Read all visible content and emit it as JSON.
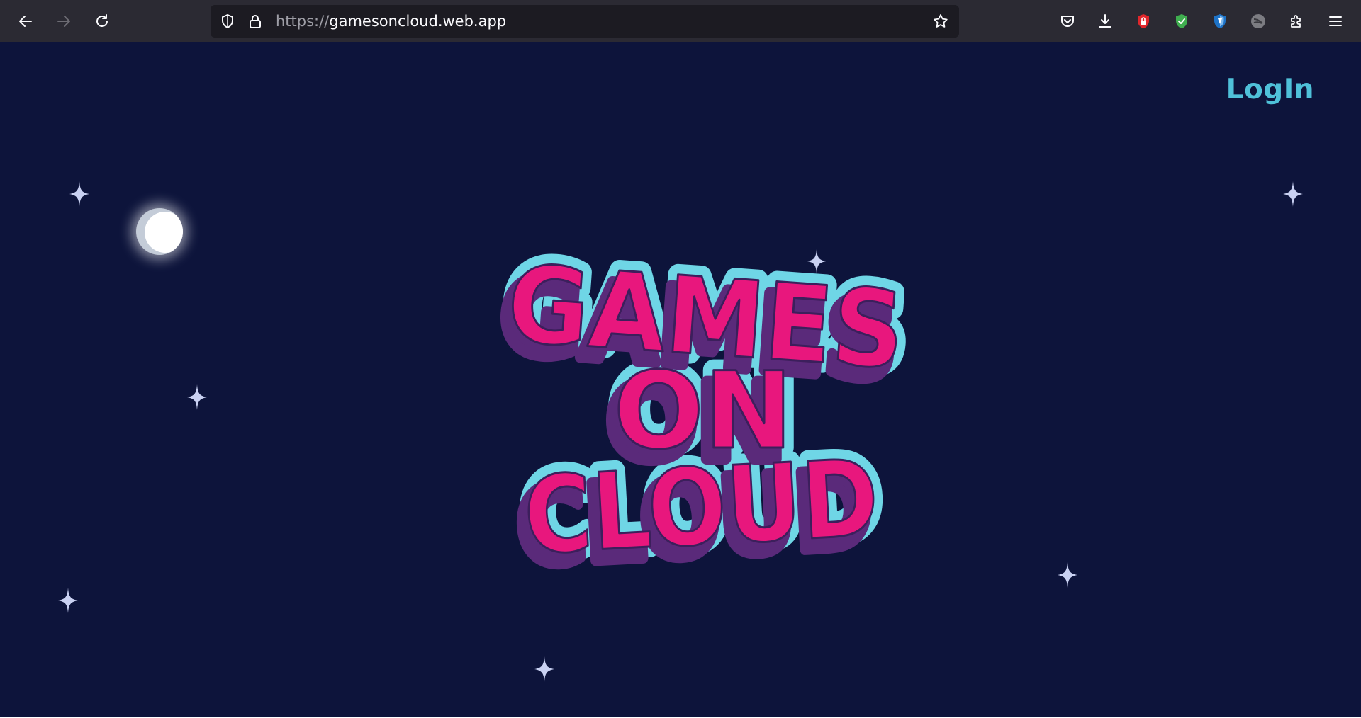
{
  "browser": {
    "url_scheme": "https://",
    "url_host": "gamesoncloud.web.app",
    "toolbar_icons": [
      "back-arrow-icon",
      "forward-arrow-icon",
      "reload-icon",
      "shield-icon",
      "lock-icon",
      "star-bookmark-icon",
      "pocket-icon",
      "download-icon",
      "extension-red-lock-icon",
      "extension-green-shield-icon",
      "extension-blue-shield-icon",
      "extension-gray-circle-icon",
      "extensions-puzzle-icon",
      "menu-hamburger-icon"
    ]
  },
  "page": {
    "login_label": "LogIn",
    "logo": {
      "line1": "GAMES",
      "line2": "ON",
      "line3": "CLOUD"
    },
    "colors": {
      "background": "#0d143b",
      "login": "#4fc1d9",
      "logo_fill": "#e8177d",
      "logo_shadow": "#5a2a7a",
      "logo_outline": "#6fd6e6",
      "star": "#c9d1f2"
    }
  }
}
